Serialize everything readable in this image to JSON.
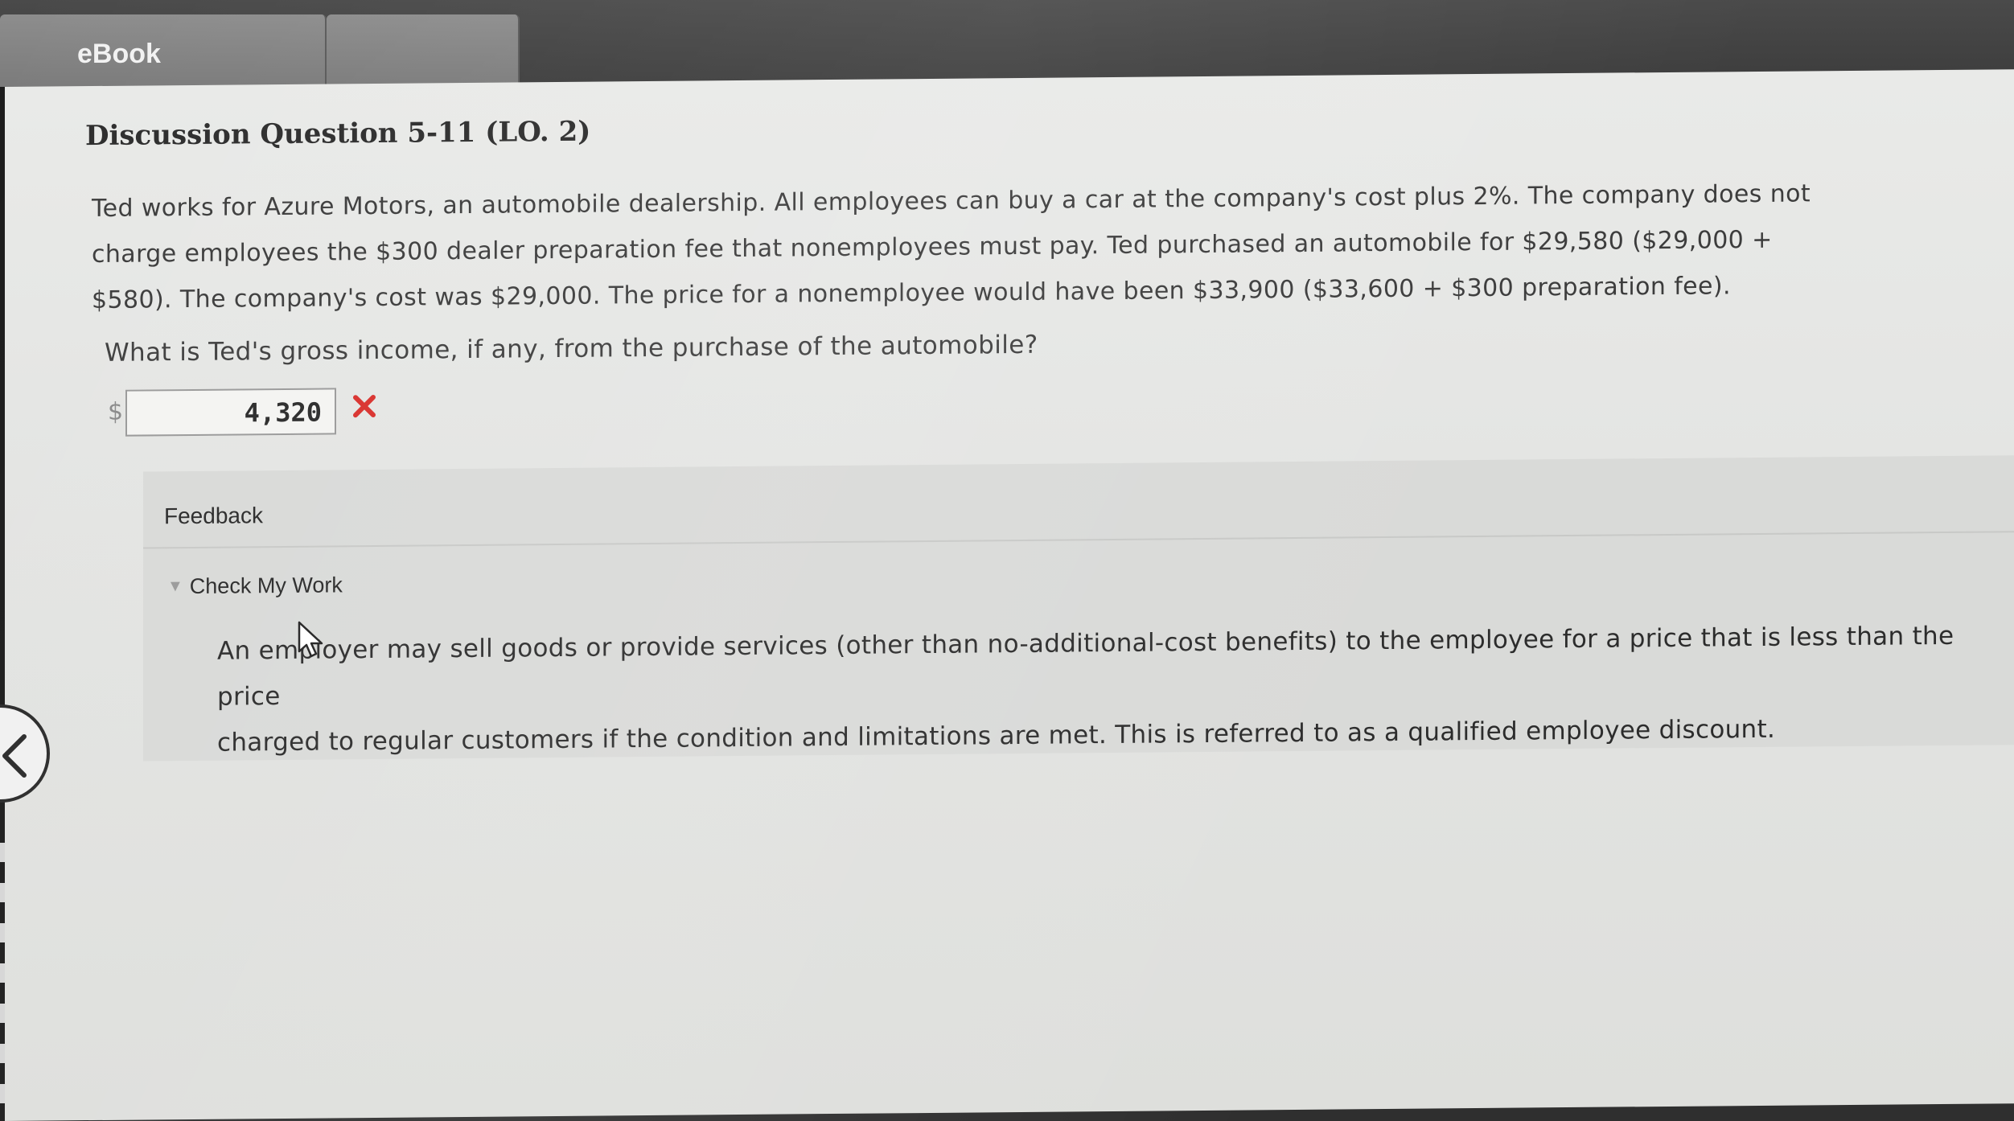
{
  "tabs": [
    {
      "label": "eBook"
    },
    {
      "label": ""
    }
  ],
  "question": {
    "title": "Discussion Question 5-11 (LO. 2)",
    "body_lines": [
      "Ted works for Azure Motors, an automobile dealership. All employees can buy a car at the company's cost plus 2%. The company does not",
      "charge employees the $300 dealer preparation fee that nonemployees must pay. Ted purchased an automobile for $29,580 ($29,000 +",
      "$580). The company's cost was $29,000. The price for a nonemployee would have been $33,900 ($33,600 + $300 preparation fee)."
    ],
    "prompt": "What is Ted's gross income, if any, from the purchase of the automobile?",
    "currency_symbol": "$",
    "answer_value": "4,320",
    "answer_status": "incorrect",
    "status_color": "#d9302c"
  },
  "feedback": {
    "header": "Feedback",
    "toggle_label": "Check My Work",
    "toggle_icon": "triangle-down-icon",
    "body_lines": [
      "An employer may sell goods or provide services (other than no-additional-cost benefits) to the employee for a price that is less than the price",
      "charged to regular customers if the condition and limitations are met. This is referred to as a qualified employee discount."
    ]
  },
  "colors": {
    "page_background": "#e6e7e5",
    "feedback_background": "#d9dad8",
    "tab_background": "#858585"
  }
}
